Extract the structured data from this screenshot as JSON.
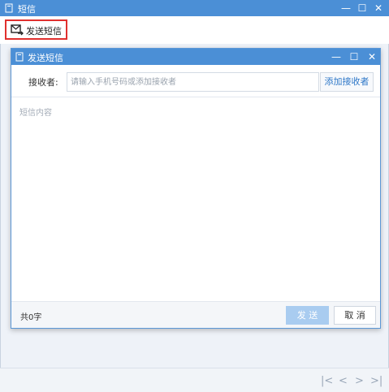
{
  "window": {
    "title": "短信",
    "controls": {
      "minimize": "—",
      "maximize": "☐",
      "close": "✕"
    }
  },
  "toolbar": {
    "send_sms_label": "发送短信",
    "send_sms_icon": "sms-send-icon",
    "highlight_color": "#e0302e"
  },
  "dialog": {
    "title": "发送短信",
    "controls": {
      "minimize": "—",
      "maximize": "☐",
      "close": "✕"
    },
    "recipient": {
      "label": "接收者:",
      "placeholder": "请输入手机号码或添加接收者",
      "value": ""
    },
    "add_recipient_label": "添加接收者",
    "content": {
      "placeholder": "短信内容",
      "value": ""
    },
    "char_count": "共0字",
    "send_label": "发 送",
    "cancel_label": "取 消"
  },
  "pager": {
    "first": "|<",
    "prev": "<",
    "next": ">",
    "last": ">|"
  },
  "colors": {
    "titlebar": "#4b8fd6",
    "send_button": "#a9ccf0",
    "link": "#2f78c8"
  }
}
